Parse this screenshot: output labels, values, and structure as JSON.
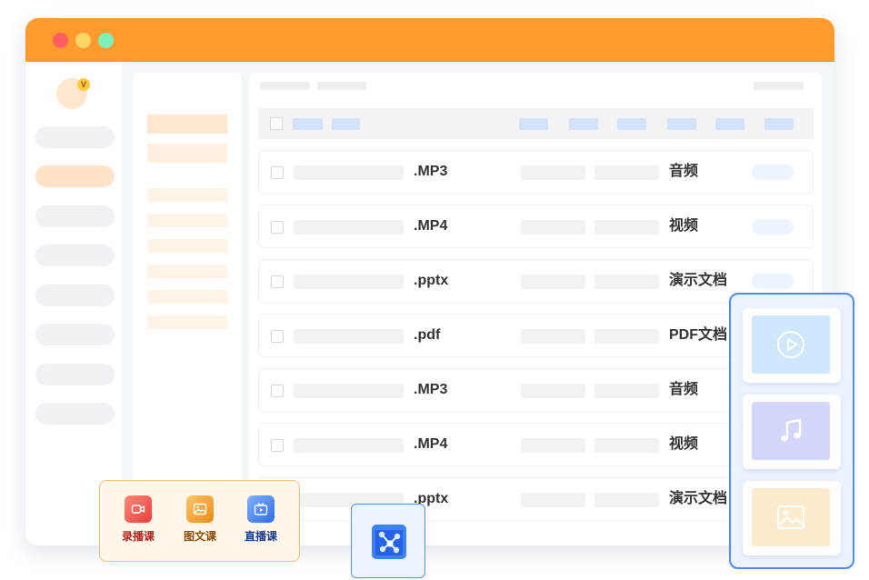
{
  "window": {
    "controls": [
      "close",
      "minimize",
      "maximize"
    ],
    "accent_color": "#ff9a2e"
  },
  "sidebar": {
    "vip_badge": "V",
    "nav_count": 8,
    "active_index": 1
  },
  "file_list": {
    "rows": [
      {
        "ext": ".MP3",
        "type": "音频"
      },
      {
        "ext": ".MP4",
        "type": "视频"
      },
      {
        "ext": ".pptx",
        "type": "演示文档"
      },
      {
        "ext": ".pdf",
        "type": "PDF文档"
      },
      {
        "ext": ".MP3",
        "type": "音频"
      },
      {
        "ext": ".MP4",
        "type": "视频"
      },
      {
        "ext": ".pptx",
        "type": "演示文档"
      }
    ]
  },
  "course_types": [
    {
      "label": "录播课",
      "icon": "video-camera-icon",
      "color": "#f04d4d"
    },
    {
      "label": "图文课",
      "icon": "picture-icon",
      "color": "#f79a1e"
    },
    {
      "label": "直播课",
      "icon": "tv-icon",
      "color": "#3f7cf5"
    }
  ],
  "share": {
    "icon": "share-nodes-icon"
  },
  "media_types": [
    {
      "icon": "play-circle-icon",
      "color": "#cfe7fc"
    },
    {
      "icon": "music-note-icon",
      "color": "#d5d6fb"
    },
    {
      "icon": "image-icon",
      "color": "#fdebcd"
    }
  ]
}
